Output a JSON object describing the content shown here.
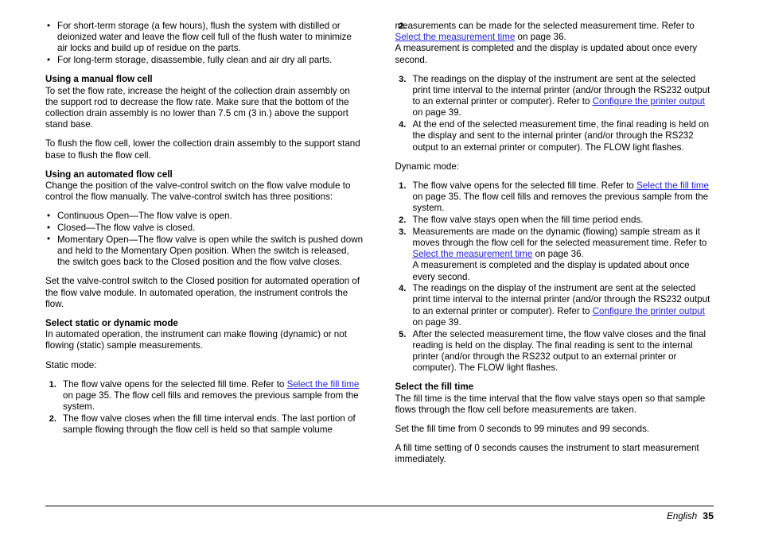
{
  "document": {
    "footer": {
      "language": "English",
      "page_number": "35"
    }
  },
  "left_column": {
    "storage_bullets": [
      "For short-term storage (a few hours), flush the system with distilled or deionized water and leave the flow cell full of the flush water to minimize air locks and build up of residue on the parts.",
      "For long-term storage, disassemble, fully clean and air dry all parts."
    ],
    "manual_flow_cell": {
      "heading": "Using a manual flow cell",
      "paragraph_1": "To set the flow rate, increase the height of the collection drain assembly on the support rod to decrease the flow rate. Make sure that the bottom of the collection drain assembly is no lower than 7.5 cm (3 in.) above the support stand base.",
      "paragraph_2": "To flush the flow cell, lower the collection drain assembly to the support stand base to flush the flow cell."
    },
    "automated_flow_cell": {
      "heading": "Using an automated flow cell",
      "paragraph_1": "Change the position of the valve-control switch on the flow valve module to control the flow manually. The valve-control switch has three positions:",
      "switch_positions": [
        "Continuous Open—The flow valve is open.",
        "Closed—The flow valve is closed.",
        "Momentary Open—The flow valve is open while the switch is pushed down and held to the Momentary Open position. When the switch is released, the switch goes back to the Closed position and the flow valve closes."
      ],
      "paragraph_2": "Set the valve-control switch to the Closed position for automated operation of the flow valve module. In automated operation, the instrument controls the flow."
    },
    "static_dynamic": {
      "heading": "Select static or dynamic mode",
      "paragraph_1": "In automated operation, the instrument can make flowing (dynamic) or not flowing (static) sample measurements.",
      "static_label": "Static mode:",
      "static_steps": [
        {
          "text_before": "The flow valve opens for the selected fill time. Refer to ",
          "link": "Select the fill time",
          "text_after": " on page 35. The flow cell fills and removes the previous sample from the system."
        },
        {
          "text_before": "The flow valve closes when the fill time interval ends. The last portion of sample flowing through the flow cell is held so that sample volume",
          "link": "",
          "text_after": ""
        }
      ]
    }
  },
  "right_column": {
    "static_steps_continued": {
      "step2_continuation": {
        "text_before": "measurements can be made for the selected measurement time. Refer to ",
        "link": "Select the measurement time",
        "text_after": " on page 36.",
        "extra_line": "A measurement is completed and the display is updated about once every second."
      },
      "step3": {
        "text_before": "The readings on the display of the instrument are sent at the selected print time interval to the internal printer (and/or through the RS232 output to an external printer or computer). Refer to ",
        "link": "Configure the printer output",
        "text_after": " on page 39."
      },
      "step4": {
        "text": "At the end of the selected measurement time, the final reading is held on the display and sent to the internal printer (and/or through the RS232 output to an external printer or computer). The FLOW light flashes."
      }
    },
    "dynamic": {
      "label": "Dynamic mode:",
      "steps": [
        {
          "text_before": "The flow valve opens for the selected fill time. Refer to ",
          "link": "Select the fill time",
          "text_after": " on page 35. The flow cell fills and removes the previous sample from the system.",
          "extra_line": ""
        },
        {
          "text_before": "The flow valve stays open when the fill time period ends.",
          "link": "",
          "text_after": "",
          "extra_line": ""
        },
        {
          "text_before": "Measurements are made on the dynamic (flowing) sample stream as it moves through the flow cell for the selected measurement time. Refer to ",
          "link": "Select the measurement time",
          "text_after": " on page 36.",
          "extra_line": "A measurement is completed and the display is updated about once every second."
        },
        {
          "text_before": "The readings on the display of the instrument are sent at the selected print time interval to the internal printer (and/or through the RS232 output to an external printer or computer). Refer to ",
          "link": "Configure the printer output",
          "text_after": " on page 39.",
          "extra_line": ""
        },
        {
          "text_before": "After the selected measurement time, the flow valve closes and the final reading is held on the display. The final reading is sent to the internal printer (and/or through the RS232 output to an external printer or computer). The FLOW light flashes.",
          "link": "",
          "text_after": "",
          "extra_line": ""
        }
      ]
    },
    "fill_time": {
      "heading": "Select the fill time",
      "paragraph_1": "The fill time is the time interval that the flow valve stays open so that sample flows through the flow cell before measurements are taken.",
      "paragraph_2": "Set the fill time from 0 seconds to 99 minutes and 99 seconds.",
      "paragraph_3": "A fill time setting of 0 seconds causes the instrument to start measurement immediately."
    }
  }
}
